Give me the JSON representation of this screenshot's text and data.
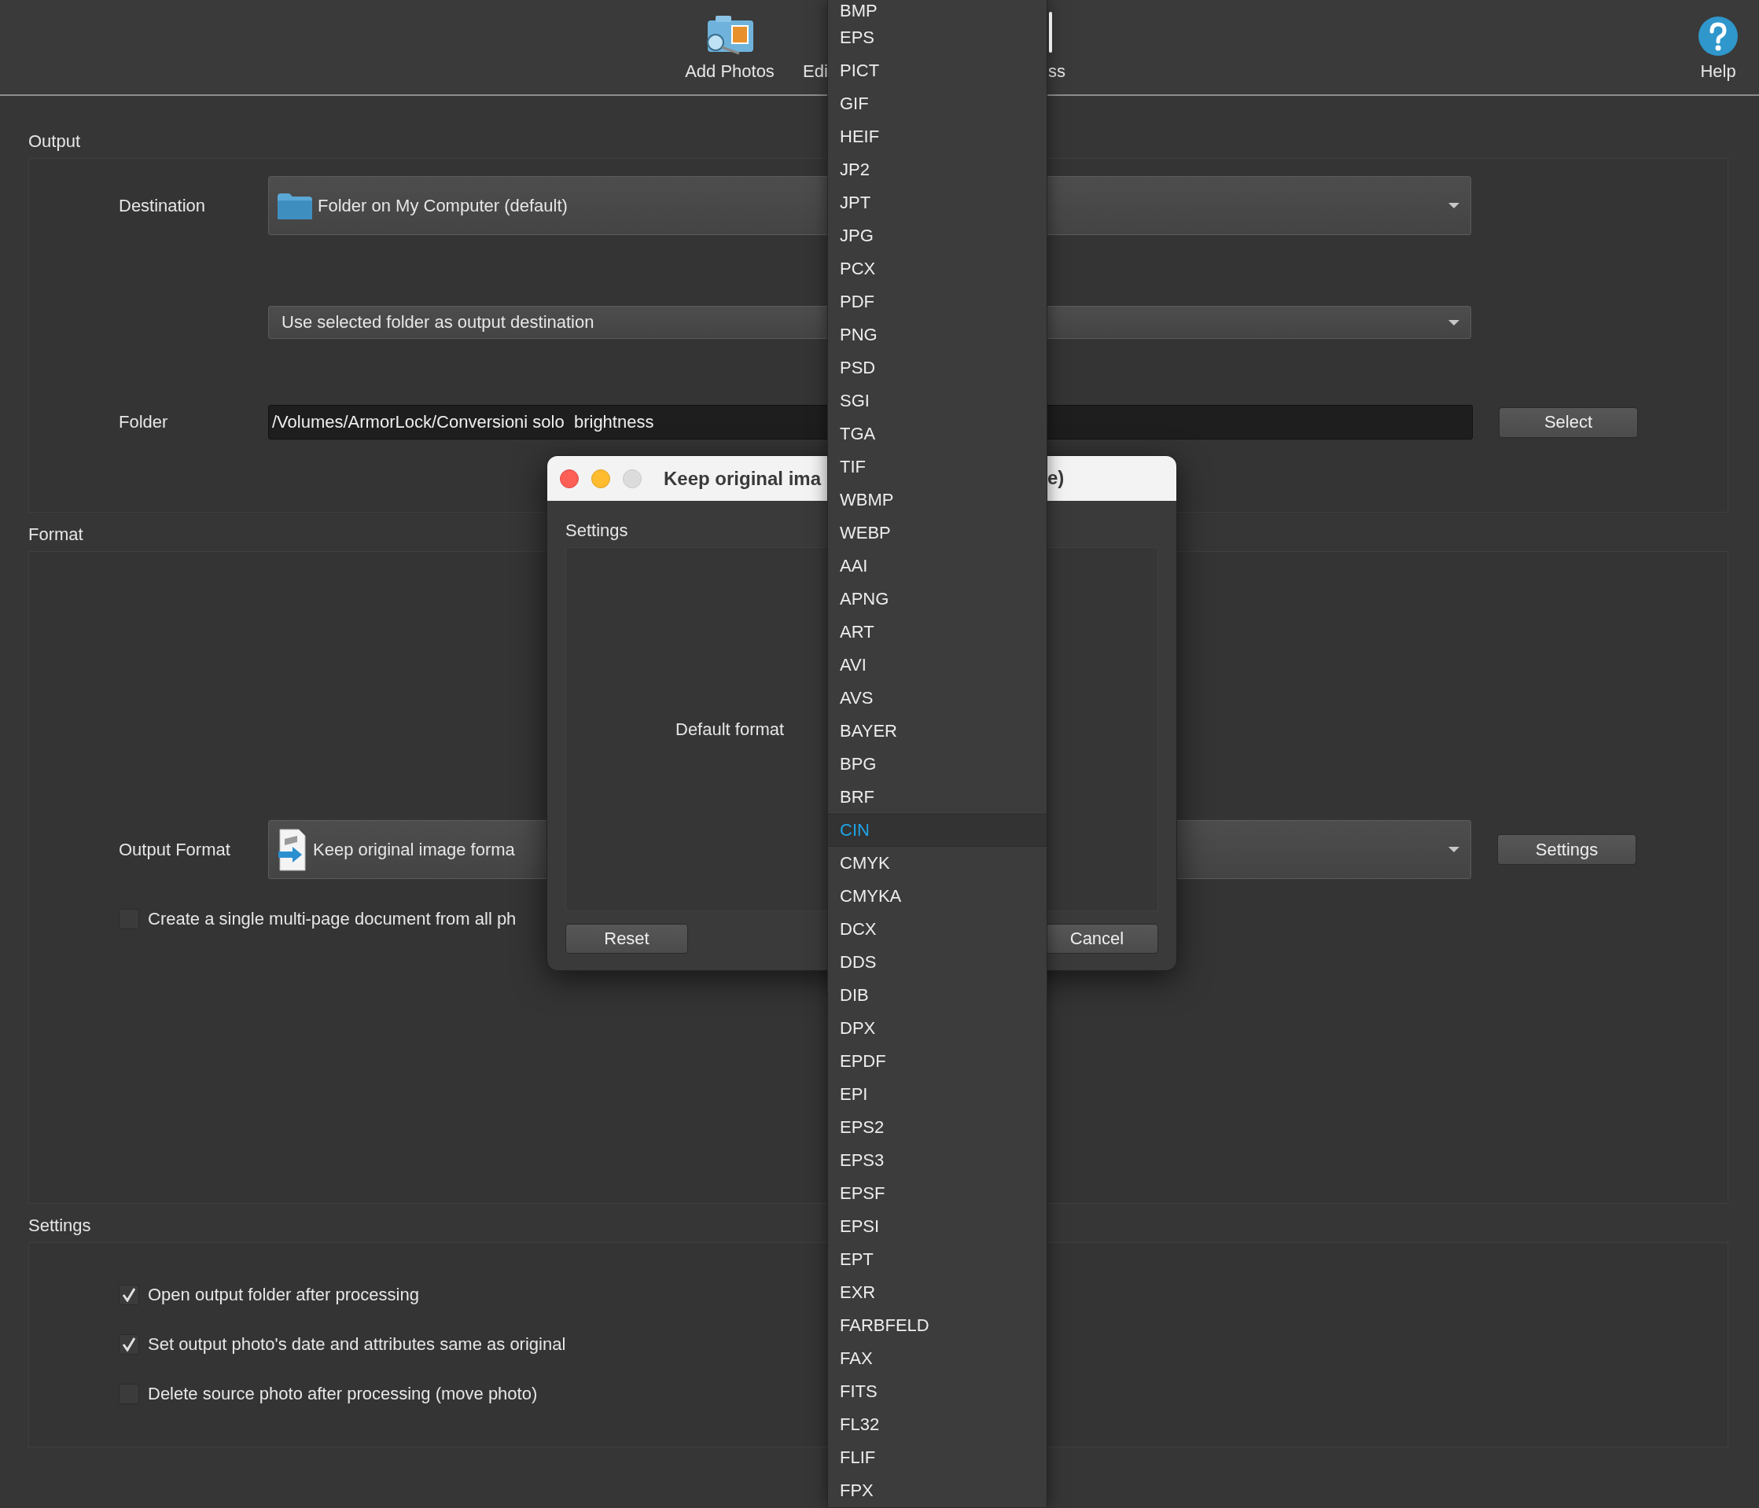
{
  "toolbar": {
    "items": [
      {
        "kind": "add-photos",
        "label": "Add Photos"
      },
      {
        "kind": "cut-left",
        "label": "Edi"
      },
      {
        "kind": "cut-right",
        "label": "ss"
      },
      {
        "kind": "help",
        "label": "Help"
      }
    ]
  },
  "output": {
    "title": "Output",
    "destination": {
      "label": "Destination",
      "value": "Folder on My Computer (default)"
    },
    "mode": {
      "value": "Use selected folder as output destination"
    },
    "folder": {
      "label": "Folder",
      "value": "/Volumes/ArmorLock/Conversioni solo  brightness",
      "button": {
        "label": "Select"
      }
    }
  },
  "format": {
    "title": "Format",
    "output_format": {
      "label": "Output Format",
      "value": "Keep original image forma",
      "button": {
        "label": "Settings"
      }
    },
    "checkboxes": [
      {
        "label": "Create a single multi-page document from all ph",
        "checked": false
      }
    ]
  },
  "settings": {
    "title": "Settings",
    "checkboxes": [
      {
        "label": "Open output folder after processing",
        "checked": true
      },
      {
        "label": "Set output photo's date and attributes same as original",
        "checked": true
      },
      {
        "label": "Delete source photo after processing (move photo)",
        "checked": false
      }
    ]
  },
  "dialog": {
    "title_parts": [
      "Keep original ima",
      "e)"
    ],
    "section": "Settings",
    "default_format": "Default format",
    "buttons": [
      {
        "label": "Reset"
      },
      {
        "label": "Cancel"
      }
    ]
  },
  "format_menu": {
    "items": [
      {
        "label": "BMP",
        "selected": false
      },
      {
        "label": "EPS",
        "selected": false
      },
      {
        "label": "PICT",
        "selected": false
      },
      {
        "label": "GIF",
        "selected": false
      },
      {
        "label": "HEIF",
        "selected": false
      },
      {
        "label": "JP2",
        "selected": false
      },
      {
        "label": "JPT",
        "selected": false
      },
      {
        "label": "JPG",
        "selected": false
      },
      {
        "label": "PCX",
        "selected": false
      },
      {
        "label": "PDF",
        "selected": false
      },
      {
        "label": "PNG",
        "selected": false
      },
      {
        "label": "PSD",
        "selected": false
      },
      {
        "label": "SGI",
        "selected": false
      },
      {
        "label": "TGA",
        "selected": false
      },
      {
        "label": "TIF",
        "selected": false
      },
      {
        "label": "WBMP",
        "selected": false
      },
      {
        "label": "WEBP",
        "selected": false
      },
      {
        "label": "AAI",
        "selected": false
      },
      {
        "label": "APNG",
        "selected": false
      },
      {
        "label": "ART",
        "selected": false
      },
      {
        "label": "AVI",
        "selected": false
      },
      {
        "label": "AVS",
        "selected": false
      },
      {
        "label": "BAYER",
        "selected": false
      },
      {
        "label": "BPG",
        "selected": false
      },
      {
        "label": "BRF",
        "selected": false
      },
      {
        "label": "CIN",
        "selected": true
      },
      {
        "label": "CMYK",
        "selected": false
      },
      {
        "label": "CMYKA",
        "selected": false
      },
      {
        "label": "DCX",
        "selected": false
      },
      {
        "label": "DDS",
        "selected": false
      },
      {
        "label": "DIB",
        "selected": false
      },
      {
        "label": "DPX",
        "selected": false
      },
      {
        "label": "EPDF",
        "selected": false
      },
      {
        "label": "EPI",
        "selected": false
      },
      {
        "label": "EPS2",
        "selected": false
      },
      {
        "label": "EPS3",
        "selected": false
      },
      {
        "label": "EPSF",
        "selected": false
      },
      {
        "label": "EPSI",
        "selected": false
      },
      {
        "label": "EPT",
        "selected": false
      },
      {
        "label": "EXR",
        "selected": false
      },
      {
        "label": "FARBFELD",
        "selected": false
      },
      {
        "label": "FAX",
        "selected": false
      },
      {
        "label": "FITS",
        "selected": false
      },
      {
        "label": "FL32",
        "selected": false
      },
      {
        "label": "FLIF",
        "selected": false
      },
      {
        "label": "FPX",
        "selected": false
      }
    ]
  }
}
